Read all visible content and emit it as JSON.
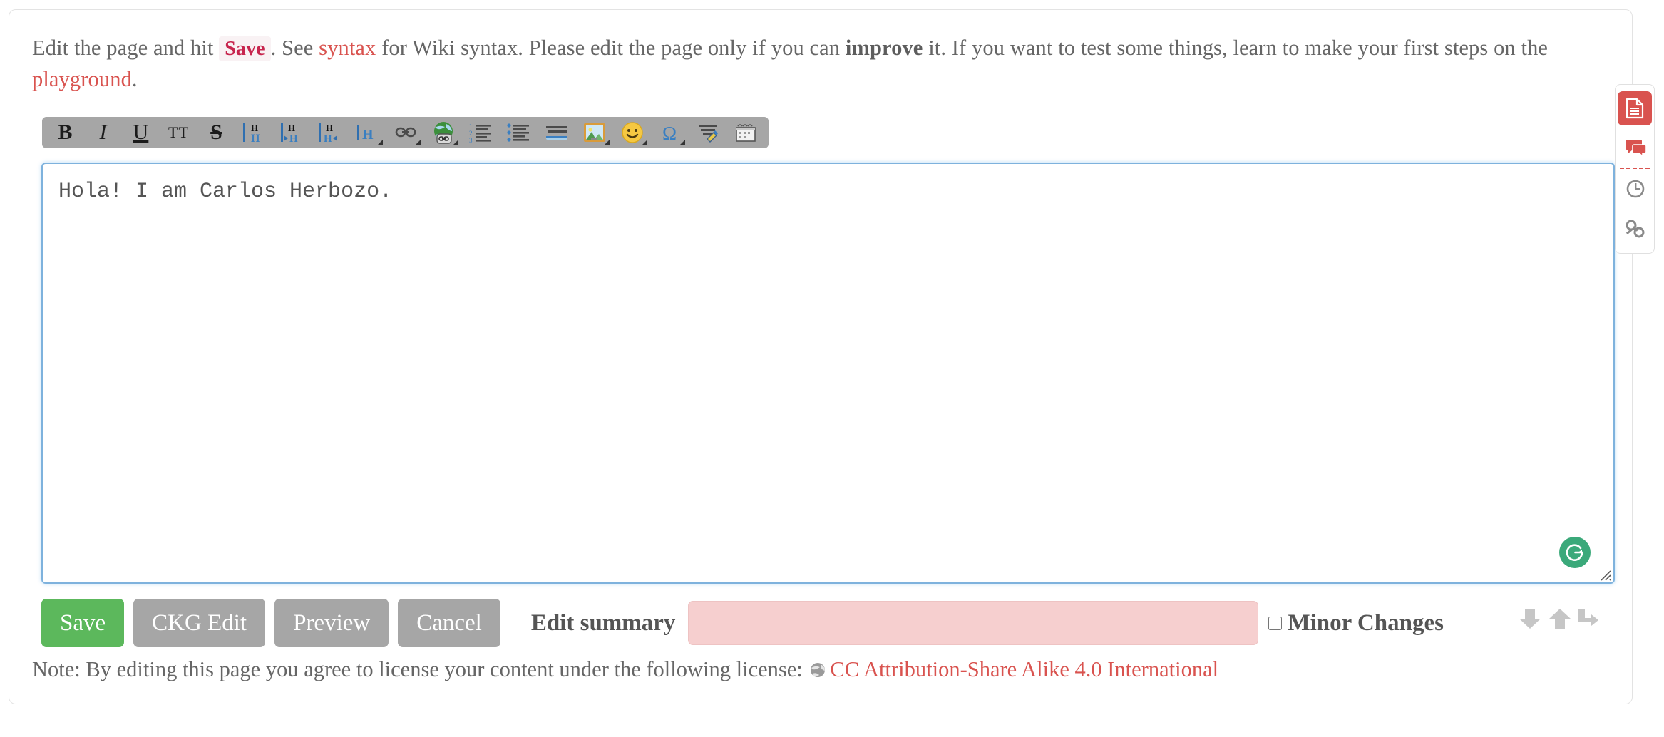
{
  "intro": {
    "segment_1": "Edit the page and hit",
    "code_save": "Save",
    "segment_2": ". See",
    "link_syntax": "syntax",
    "segment_3": "for Wiki syntax. Please edit the page only if you can",
    "bold_improve": "improve",
    "segment_4": "it. If you want to test some things, learn to make your first steps on the",
    "link_playground": "playground",
    "segment_5": "."
  },
  "toolbar": {
    "buttons": [
      {
        "name": "bold",
        "label": "B",
        "title": "Bold Text [B]"
      },
      {
        "name": "italic",
        "label": "I",
        "title": "Italic Text [I]"
      },
      {
        "name": "underline",
        "label": "U",
        "title": "Underlined Text [U]"
      },
      {
        "name": "monospace",
        "label": "TT",
        "title": "Monospaced Text [M]"
      },
      {
        "name": "strikethrough",
        "label": "S",
        "title": "Strike-through Text [D]"
      },
      {
        "name": "headline-same-level",
        "label": "H",
        "title": "Same Level Headline [8]"
      },
      {
        "name": "headline-lower-level",
        "label": "H",
        "title": "Lower Headline [9]"
      },
      {
        "name": "headline-higher-level",
        "label": "H",
        "title": "Higher Headline [0]"
      },
      {
        "name": "headline-select",
        "label": "H",
        "title": "Select Headline"
      },
      {
        "name": "internal-link",
        "label": "link",
        "title": "Internal Link [L]"
      },
      {
        "name": "external-link",
        "label": "globe-link",
        "title": "External Link"
      },
      {
        "name": "ordered-list",
        "label": "ol",
        "title": "Ordered List Item [-]"
      },
      {
        "name": "unordered-list",
        "label": "ul",
        "title": "Unordered List Item [.]"
      },
      {
        "name": "horizontal-rule",
        "label": "hr",
        "title": "Horizontal Rule"
      },
      {
        "name": "add-image",
        "label": "image",
        "title": "Add Images and other files"
      },
      {
        "name": "smiley",
        "label": "smiley",
        "title": "Smileys"
      },
      {
        "name": "special-chars",
        "label": "omega",
        "title": "Special Chars"
      },
      {
        "name": "signature",
        "label": "signature",
        "title": "Insert Signature"
      },
      {
        "name": "date",
        "label": "date",
        "title": "Insert date"
      }
    ]
  },
  "editor": {
    "value": "Hola! I am Carlos Herbozo.",
    "placeholder": ""
  },
  "grammarly": {
    "letter": "G"
  },
  "controls": {
    "save_label": "Save",
    "ckg_edit_label": "CKG Edit",
    "preview_label": "Preview",
    "cancel_label": "Cancel",
    "summary_label": "Edit summary",
    "summary_value": "",
    "summary_placeholder": "",
    "minor_changes_label": "Minor Changes",
    "minor_changes_checked": false
  },
  "note": {
    "prefix": "Note: By editing this page you agree to license your content under the following license:",
    "license_link": "CC Attribution-Share Alike 4.0 International"
  },
  "siderail": {
    "items": [
      {
        "name": "page-icon",
        "active": true
      },
      {
        "name": "discussion-icon",
        "active": false
      },
      {
        "name": "history-icon",
        "active": false
      },
      {
        "name": "backlinks-icon",
        "active": false
      }
    ]
  },
  "colors": {
    "accent_red": "#d9534f",
    "save_green": "#5cb85c",
    "toolbar_grey": "#a6a6a6",
    "summary_pink": "#f6cfcf",
    "focus_blue": "#7eb2dd",
    "grammarly_green": "#3ba97a"
  }
}
